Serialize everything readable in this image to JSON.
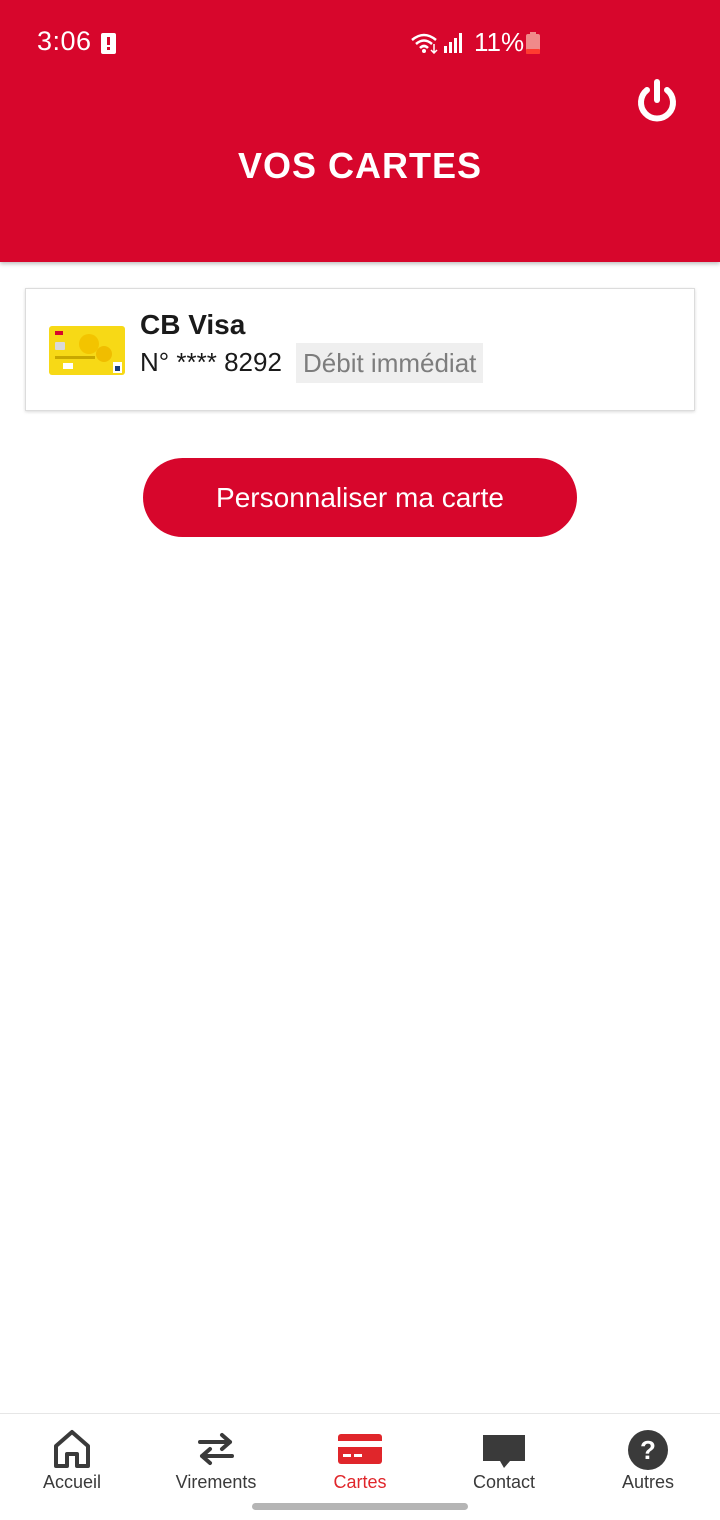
{
  "status_bar": {
    "time": "3:06",
    "battery": "11%",
    "icons": [
      "alert-icon",
      "wifi-icon",
      "signal-icon",
      "battery-icon"
    ]
  },
  "header": {
    "title": "VOS CARTES",
    "background_color": "#d7062c",
    "power_icon": "power-icon"
  },
  "card": {
    "name": "CB Visa",
    "number": "N° **** 8292",
    "type": "Débit immédiat",
    "thumbnail_color": "#f7d916"
  },
  "actions": {
    "customize_label": "Personnaliser ma carte"
  },
  "bottom_nav": {
    "items": [
      {
        "label": "Accueil",
        "icon": "home-icon",
        "active": false
      },
      {
        "label": "Virements",
        "icon": "transfer-icon",
        "active": false
      },
      {
        "label": "Cartes",
        "icon": "card-icon",
        "active": true
      },
      {
        "label": "Contact",
        "icon": "chat-icon",
        "active": false
      },
      {
        "label": "Autres",
        "icon": "help-icon",
        "active": false
      }
    ],
    "active_color": "#e0262b"
  }
}
